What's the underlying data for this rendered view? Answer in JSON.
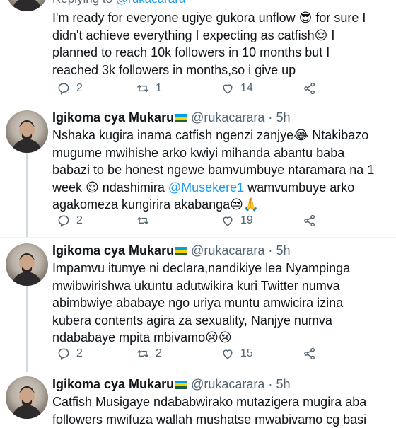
{
  "replying": {
    "prefix": "Replying to",
    "handle": "@rukacarara"
  },
  "author": {
    "name": "Igikoma cya Mukaru",
    "handle": "@rukacarara",
    "dot": "·"
  },
  "tweets": [
    {
      "time": "",
      "lines": [
        "I'm ready for everyone ugiye gukora unflow 😎 for sure I",
        "didn't achieve everything I expecting as catfish😌 I",
        "planned to reach 10k followers in 10 months but I",
        "reached 3k followers in months,so i give up"
      ],
      "replies": "2",
      "retweets": "1",
      "likes": "14"
    },
    {
      "time": "5h",
      "lines": [
        "Nshaka kugira inama catfish ngenzi zanjye😂 Ntakibazo",
        "mugume mwihishe arko kwiyi mihanda abantu baba",
        "babazi  to be honest ngewe bamvumbuye ntaramara na 1",
        "week 😌 ndashimira @Musekere1 wamvumbuye arko",
        "agakomeza kungirira akabanga😒🙏"
      ],
      "replies": "2",
      "retweets": "",
      "likes": "19"
    },
    {
      "time": "5h",
      "lines": [
        "Impamvu itumye ni declara,nandikiye lea Nyampinga",
        "mwibwirishwa ukuntu adutwikira kuri Twitter numva",
        "abimbwiye ababaye ngo uriya muntu amwicira izina",
        "kubera contents agira za sexuality, Nanjye numva",
        "ndababaye mpita mbivamo😢😢"
      ],
      "replies": "2",
      "retweets": "2",
      "likes": "15"
    },
    {
      "time": "5h",
      "lines": [
        "Catfish Musigaye ndababwirako mutazigera mugira aba",
        "followers mwifuza wallah mushatse mwabivamo cg basi"
      ],
      "replies": "",
      "retweets": "",
      "likes": ""
    }
  ],
  "colors": {
    "accent": "#1d9bf0",
    "muted": "#536471",
    "text": "#0f1419",
    "thread": "#cfd9de"
  },
  "icons": [
    "reply-icon",
    "retweet-icon",
    "like-icon",
    "share-icon",
    "rwanda-flag-icon"
  ]
}
